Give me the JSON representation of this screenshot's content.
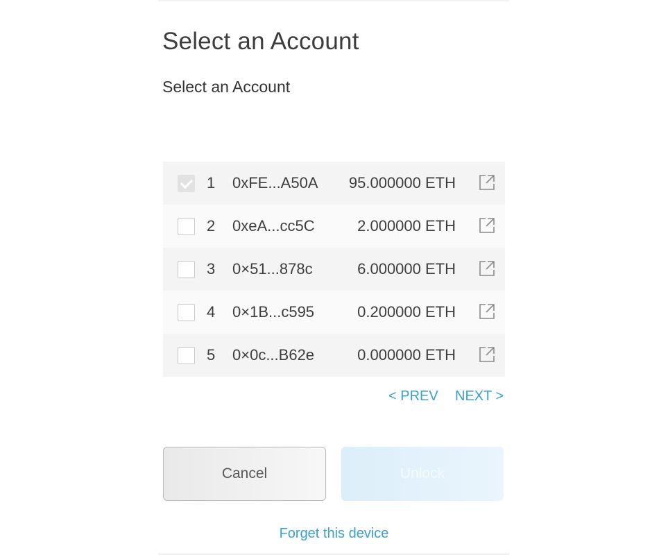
{
  "header": {
    "title": "Select an Account",
    "subtitle": "Select an Account"
  },
  "accounts": [
    {
      "index": "1",
      "address": "0xFE...A50A",
      "balance": "95.000000 ETH",
      "selected": true
    },
    {
      "index": "2",
      "address": "0xeA...cc5C",
      "balance": "2.000000 ETH",
      "selected": false
    },
    {
      "index": "3",
      "address": "0×51...878c",
      "balance": "6.000000 ETH",
      "selected": false
    },
    {
      "index": "4",
      "address": "0×1B...c595",
      "balance": "0.200000 ETH",
      "selected": false
    },
    {
      "index": "5",
      "address": "0×0c...B62e",
      "balance": "0.000000 ETH",
      "selected": false
    }
  ],
  "pagination": {
    "prev_label": "< PREV",
    "next_label": "NEXT >"
  },
  "actions": {
    "cancel_label": "Cancel",
    "unlock_label": "Unlock",
    "forget_label": "Forget this device"
  },
  "icons": {
    "checkbox": "checkbox-icon",
    "external_link": "external-link-icon"
  },
  "colors": {
    "link": "#3aa0cc",
    "unlock_disabled_bg": "#dceefa",
    "row_alt_bg": "#f4f4f4"
  }
}
